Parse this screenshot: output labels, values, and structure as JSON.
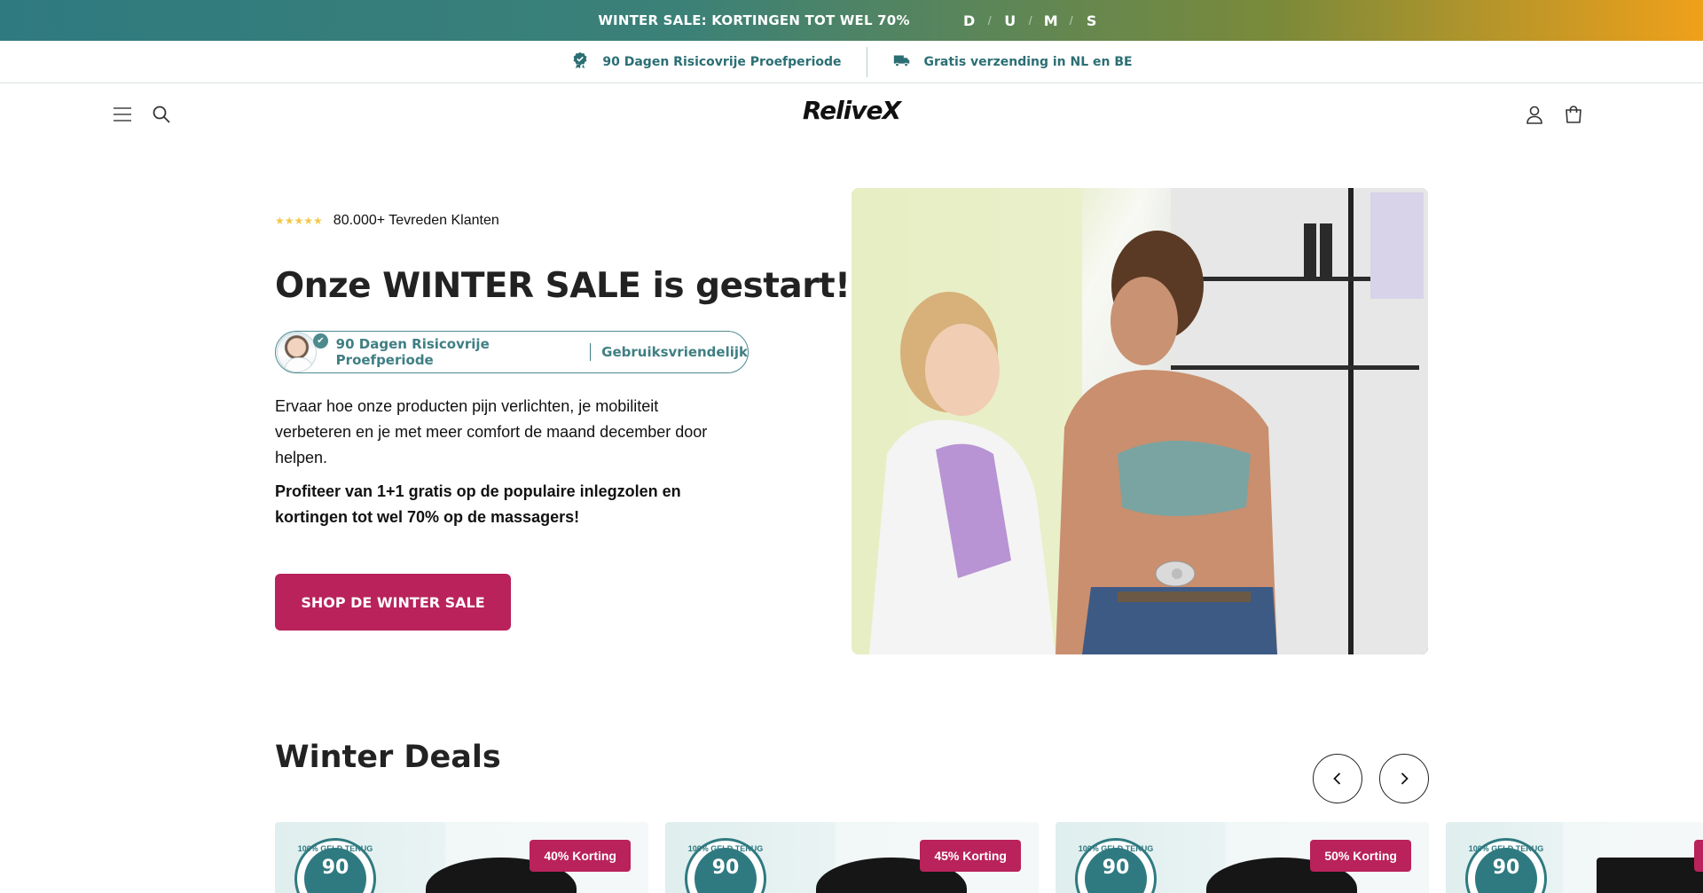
{
  "announcement": {
    "text": "WINTER SALE: KORTINGEN TOT WEL 70%",
    "countdown": [
      "D",
      "U",
      "M",
      "S"
    ],
    "separator": "/"
  },
  "trust": {
    "items": [
      {
        "icon": "badge-check-icon",
        "label": "90 Dagen Risicovrije Proefperiode"
      },
      {
        "icon": "truck-icon",
        "label": "Gratis verzending in NL en BE"
      }
    ]
  },
  "header": {
    "logo": "ReliveX",
    "icons": [
      "menu-icon",
      "search-icon",
      "account-icon",
      "cart-icon"
    ]
  },
  "hero": {
    "stars": "★★★★★",
    "rating_text": "80.000+ Tevreden Klanten",
    "title": "Onze WINTER SALE is gestart!",
    "pill": {
      "left": "90 Dagen Risicovrije Proefperiode",
      "right": "Gebruiksvriendelijk"
    },
    "description": "Ervaar hoe onze producten pijn verlichten, je mobiliteit verbeteren en je met meer comfort de maand december door helpen.",
    "highlight": "Profiteer van 1+1 gratis op de populaire inlegzolen en kortingen tot wel 70% op de massagers!",
    "cta_label": "SHOP DE WINTER SALE"
  },
  "deals": {
    "title": "Winter Deals",
    "cards": [
      {
        "badge": "40% Korting",
        "seal_number": "90",
        "seal_text": "100% GELD TERUG"
      },
      {
        "badge": "45% Korting",
        "seal_number": "90",
        "seal_text": "100% GELD TERUG"
      },
      {
        "badge": "50% Korting",
        "seal_number": "90",
        "seal_text": "100% GELD TERUG"
      },
      {
        "badge": "",
        "seal_number": "90",
        "seal_text": "100% GELD TERUG"
      }
    ]
  },
  "colors": {
    "accent": "#b9225a",
    "teal": "#2f7a80",
    "gold": "#f0a01a"
  }
}
